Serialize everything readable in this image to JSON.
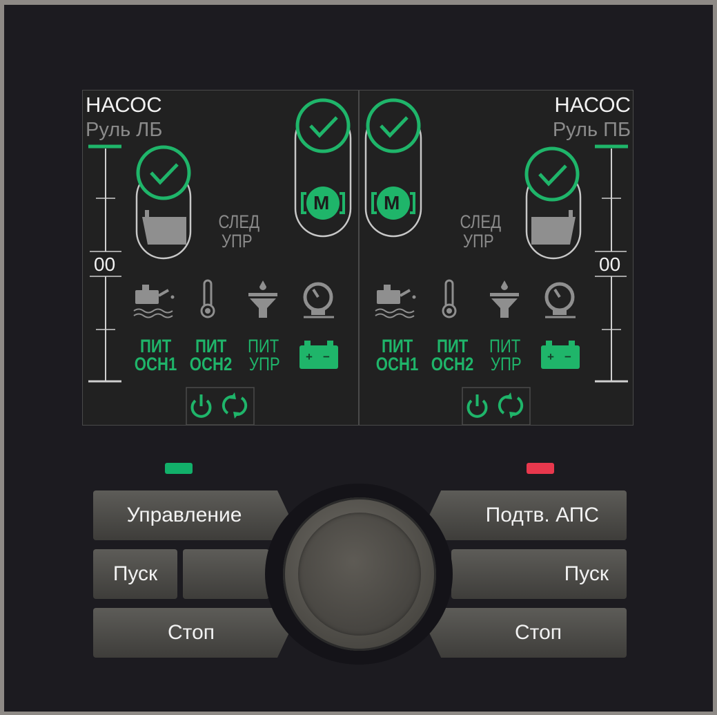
{
  "left_panel": {
    "title": "НАСОС",
    "subtitle": "Руль ЛБ",
    "scale_value": "00",
    "mode_line1": "СЛЕД",
    "mode_line2": "УПР",
    "power1_line1": "ПИТ",
    "power1_line2": "ОСН1",
    "power2_line1": "ПИТ",
    "power2_line2": "ОСН2",
    "power3_line1": "ПИТ",
    "power3_line2": "УПР",
    "motor_label": "M"
  },
  "right_panel": {
    "title": "НАСОС",
    "subtitle": "Руль ПБ",
    "scale_value": "00",
    "mode_line1": "СЛЕД",
    "mode_line2": "УПР",
    "power1_line1": "ПИТ",
    "power1_line2": "ОСН1",
    "power2_line1": "ПИТ",
    "power2_line2": "ОСН2",
    "power3_line1": "ПИТ",
    "power3_line2": "УПР",
    "motor_label": "M"
  },
  "battery_labels": {
    "plus": "+",
    "minus": "−"
  },
  "buttons": {
    "control": "Управление",
    "start_left": "Пуск",
    "stop_left": "Стоп",
    "ack": "Подтв. АПС",
    "start_right": "Пуск",
    "stop_right": "Стоп"
  },
  "icons": [
    "check-icon",
    "tank-icon",
    "motor-icon",
    "oil-level-icon",
    "thermometer-icon",
    "filter-icon",
    "pressure-gauge-icon",
    "battery-icon",
    "power-icon",
    "refresh-icon"
  ],
  "colors": {
    "accent_green": "#1fb56a",
    "indicator_red": "#e8384d",
    "indicator_green": "#12b06a",
    "panel_bg": "#212121"
  }
}
